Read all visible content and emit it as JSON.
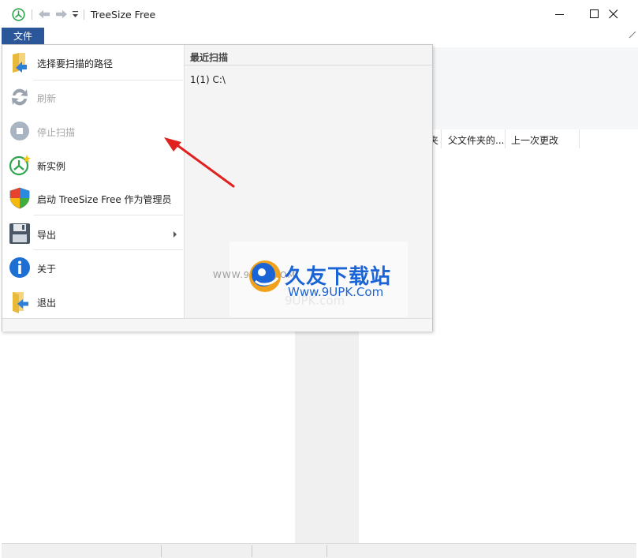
{
  "window": {
    "title": "TreeSize Free",
    "controls": {
      "minimize": "minimize-icon",
      "maximize": "maximize-icon",
      "close": "close-icon"
    }
  },
  "file_tab": {
    "label": "文件"
  },
  "file_menu": {
    "items": [
      {
        "label": "选择要扫描的路径",
        "icon": "folder-arrow-icon",
        "enabled": true
      },
      {
        "label": "刷新",
        "icon": "refresh-icon",
        "enabled": false
      },
      {
        "label": "停止扫描",
        "icon": "stop-icon",
        "enabled": false
      },
      {
        "label": "新实例",
        "icon": "new-instance-icon",
        "enabled": true
      },
      {
        "label": "启动 TreeSize Free 作为管理员",
        "icon": "uac-shield-icon",
        "enabled": true
      },
      {
        "label": "导出",
        "icon": "floppy-disk-icon",
        "enabled": true,
        "submenu": true
      },
      {
        "label": "关于",
        "icon": "info-icon",
        "enabled": true
      },
      {
        "label": "退出",
        "icon": "exit-icon",
        "enabled": true
      }
    ],
    "recent": {
      "heading": "最近扫描",
      "items": [
        {
          "label": "1(1)  C:\\"
        }
      ]
    }
  },
  "columns": [
    "夹",
    "父文件夹的...",
    "上一次更改"
  ],
  "watermark": {
    "site_url_faint": "WWW.9UPK.COM",
    "site_name": "久友下载站",
    "site_url": "Www.9UPK.Com",
    "faint_text": "9UPK.com"
  },
  "colors": {
    "file_tab_bg": "#2b579a",
    "annotation_arrow": "#e0211f",
    "watermark_blue": "#1a64d6"
  }
}
